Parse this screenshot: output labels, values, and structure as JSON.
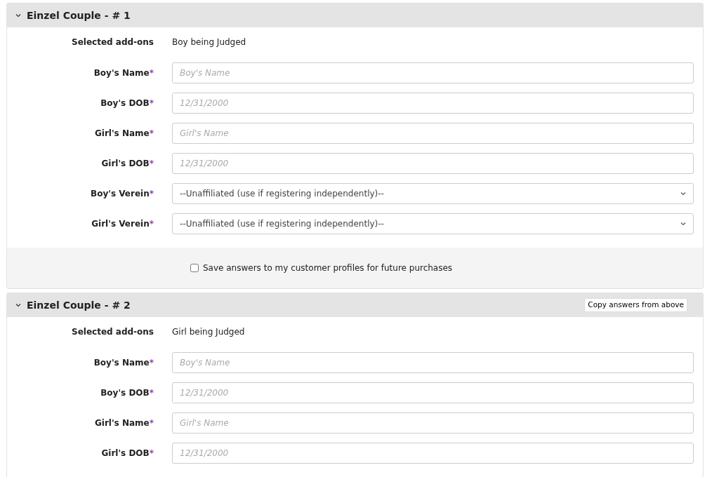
{
  "sections": [
    {
      "title": "Einzel Couple - # 1",
      "expanded": true,
      "addons_label": "Selected add-ons",
      "addons_value": "Boy being Judged",
      "fields": [
        {
          "kind": "input",
          "label": "Boy's Name",
          "required_mark": "*",
          "placeholder": "Boy's Name"
        },
        {
          "kind": "input",
          "label": "Boy's DOB",
          "required_mark": "*",
          "placeholder": "12/31/2000"
        },
        {
          "kind": "input",
          "label": "Girl's Name",
          "required_mark": "*",
          "placeholder": "Girl's Name"
        },
        {
          "kind": "input",
          "label": "Girl's DOB",
          "required_mark": "*",
          "placeholder": "12/31/2000"
        },
        {
          "kind": "select",
          "label": "Boy's Verein",
          "required_mark": "*",
          "value": "--Unaffiliated (use if registering independently)--"
        },
        {
          "kind": "select",
          "label": "Girl's Verein",
          "required_mark": "*",
          "value": "--Unaffiliated (use if registering independently)--"
        }
      ],
      "save_option": {
        "label": "Save answers to my customer profiles for future purchases",
        "checked": false
      }
    },
    {
      "title": "Einzel Couple - # 2",
      "expanded": true,
      "copy_button": "Copy answers from above",
      "addons_label": "Selected add-ons",
      "addons_value": "Girl being Judged",
      "fields": [
        {
          "kind": "input",
          "label": "Boy's Name",
          "required_mark": "*",
          "placeholder": "Boy's Name"
        },
        {
          "kind": "input",
          "label": "Boy's DOB",
          "required_mark": "*",
          "placeholder": "12/31/2000"
        },
        {
          "kind": "input",
          "label": "Girl's Name",
          "required_mark": "*",
          "placeholder": "Girl's Name"
        },
        {
          "kind": "input",
          "label": "Girl's DOB",
          "required_mark": "*",
          "placeholder": "12/31/2000"
        }
      ]
    }
  ]
}
